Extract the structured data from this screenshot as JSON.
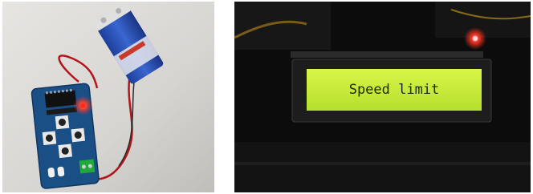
{
  "right_photo": {
    "lcd_text": "Speed limit"
  },
  "colors": {
    "pcb_blue": "#1a4f86",
    "battery_blue": "#2a52b8",
    "led_red": "#ff2a1a",
    "lcd_green": "#c8ee3a",
    "wire_red": "#b5151a",
    "terminal_green": "#1faa3a"
  }
}
